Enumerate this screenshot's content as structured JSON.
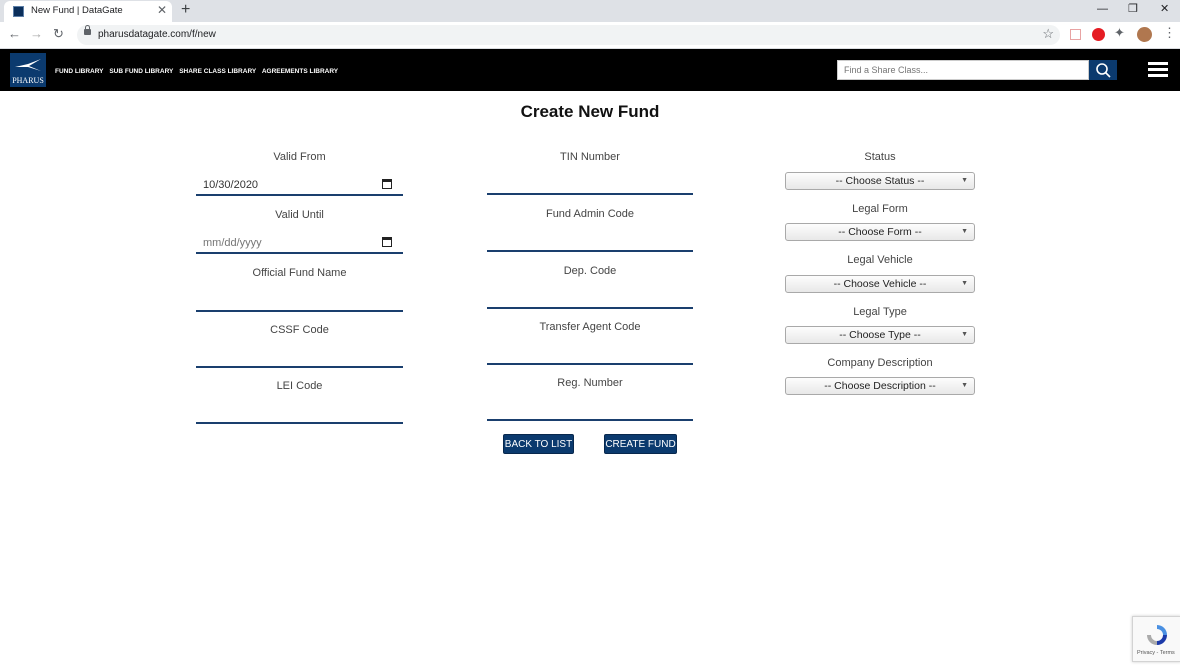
{
  "browser": {
    "tab_title": "New Fund | DataGate",
    "url": "pharusdatagate.com/f/new"
  },
  "header": {
    "logo_text": "PHARUS",
    "nav": [
      "FUND LIBRARY",
      "SUB FUND LIBRARY",
      "SHARE CLASS LIBRARY",
      "AGREEMENTS LIBRARY"
    ],
    "search_placeholder": "Find a Share Class..."
  },
  "form": {
    "title": "Create New Fund",
    "left": {
      "valid_from_label": "Valid From",
      "valid_from_value": "10/30/2020",
      "valid_until_label": "Valid Until",
      "valid_until_placeholder": "mm/dd/yyyy",
      "official_fund_name_label": "Official Fund Name",
      "cssf_code_label": "CSSF Code",
      "lei_code_label": "LEI Code"
    },
    "middle": {
      "tin_label": "TIN Number",
      "fund_admin_label": "Fund Admin Code",
      "dep_code_label": "Dep. Code",
      "transfer_agent_label": "Transfer Agent Code",
      "reg_number_label": "Reg. Number"
    },
    "right": {
      "status_label": "Status",
      "status_value": "-- Choose Status --",
      "legal_form_label": "Legal Form",
      "legal_form_value": "-- Choose Form --",
      "legal_vehicle_label": "Legal Vehicle",
      "legal_vehicle_value": "-- Choose Vehicle --",
      "legal_type_label": "Legal Type",
      "legal_type_value": "-- Choose Type --",
      "company_description_label": "Company Description",
      "company_description_value": "-- Choose Description --"
    },
    "back_button": "BACK TO LIST",
    "create_button": "CREATE FUND"
  },
  "recaptcha_text": "Privacy - Terms",
  "colors": {
    "brand": "#0b3a6e",
    "header_bg": "#000000",
    "underline": "#1a3f6e"
  }
}
